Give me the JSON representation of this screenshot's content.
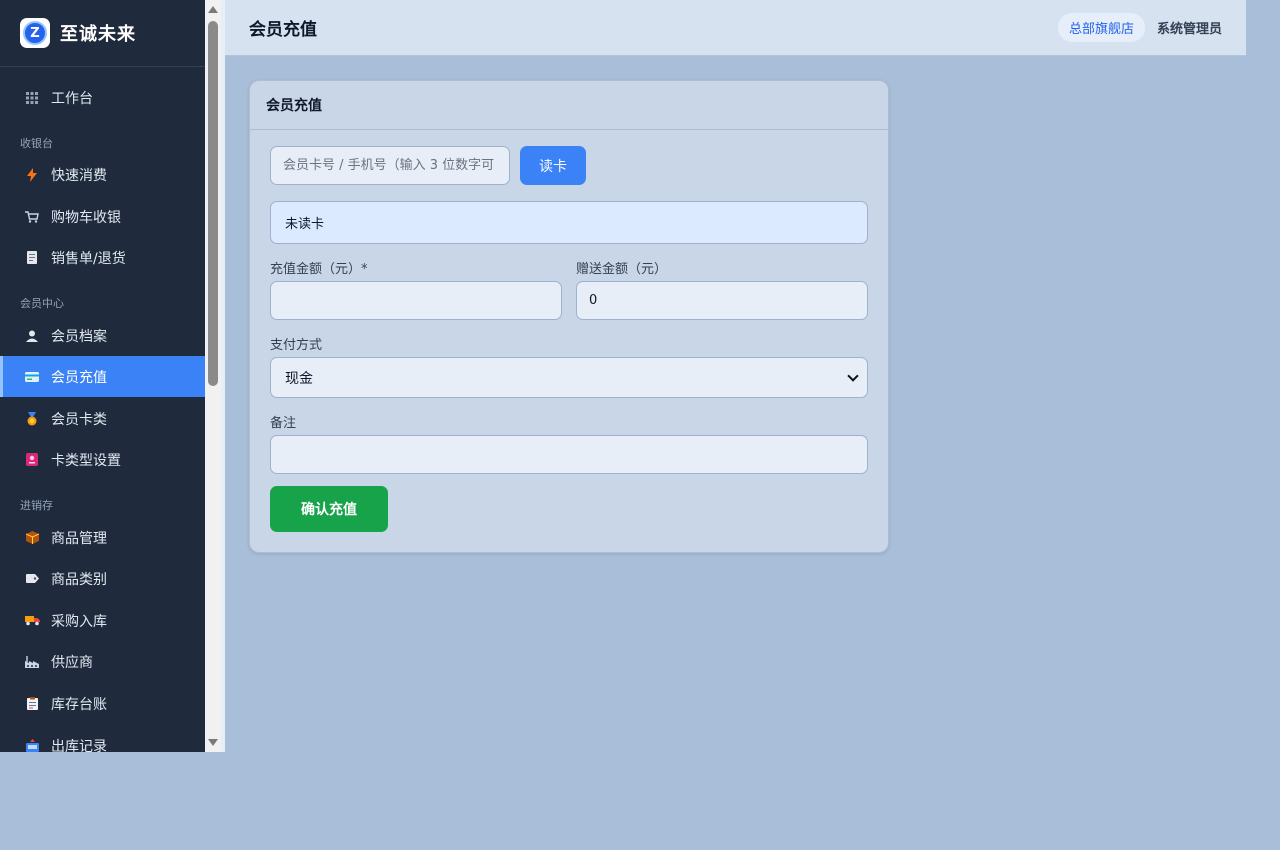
{
  "brand": {
    "name": "至诚未来",
    "logo_letter": "Z"
  },
  "sidebar": {
    "workbench": {
      "label": "工作台",
      "icon": "grid-icon"
    },
    "sections": {
      "cashier": "收银台",
      "member": "会员中心",
      "inventory": "进销存"
    },
    "items": [
      {
        "label": "快速消费",
        "icon": "lightning-icon"
      },
      {
        "label": "购物车收银",
        "icon": "cart-icon"
      },
      {
        "label": "销售单/退货",
        "icon": "receipt-icon"
      },
      {
        "label": "会员档案",
        "icon": "user-icon"
      },
      {
        "label": "会员充值",
        "icon": "card-icon",
        "active": true
      },
      {
        "label": "会员卡类",
        "icon": "medal-icon"
      },
      {
        "label": "卡类型设置",
        "icon": "card-settings-icon"
      },
      {
        "label": "商品管理",
        "icon": "box-icon"
      },
      {
        "label": "商品类别",
        "icon": "tag-icon"
      },
      {
        "label": "采购入库",
        "icon": "truck-icon"
      },
      {
        "label": "供应商",
        "icon": "factory-icon"
      },
      {
        "label": "库存台账",
        "icon": "clipboard-icon"
      },
      {
        "label": "出库记录",
        "icon": "outbox-icon"
      }
    ]
  },
  "header": {
    "title": "会员充值",
    "store": "总部旗舰店",
    "user": "系统管理员"
  },
  "card": {
    "title": "会员充值",
    "search_placeholder": "会员卡号 / 手机号（输入 3 位数字可",
    "search_value": "",
    "read_button": "读卡",
    "status_text": "未读卡",
    "amount_label": "充值金额（元）*",
    "amount_value": "",
    "bonus_label": "赠送金额（元）",
    "bonus_value": "0",
    "payment_label": "支付方式",
    "payment_selected": "现金",
    "remark_label": "备注",
    "remark_value": "",
    "confirm_button": "确认充值"
  },
  "colors": {
    "sidebar_bg": "#1f2a3d",
    "accent": "#3b82f6",
    "confirm": "#16a34a",
    "page_bg": "#a9bed8"
  }
}
